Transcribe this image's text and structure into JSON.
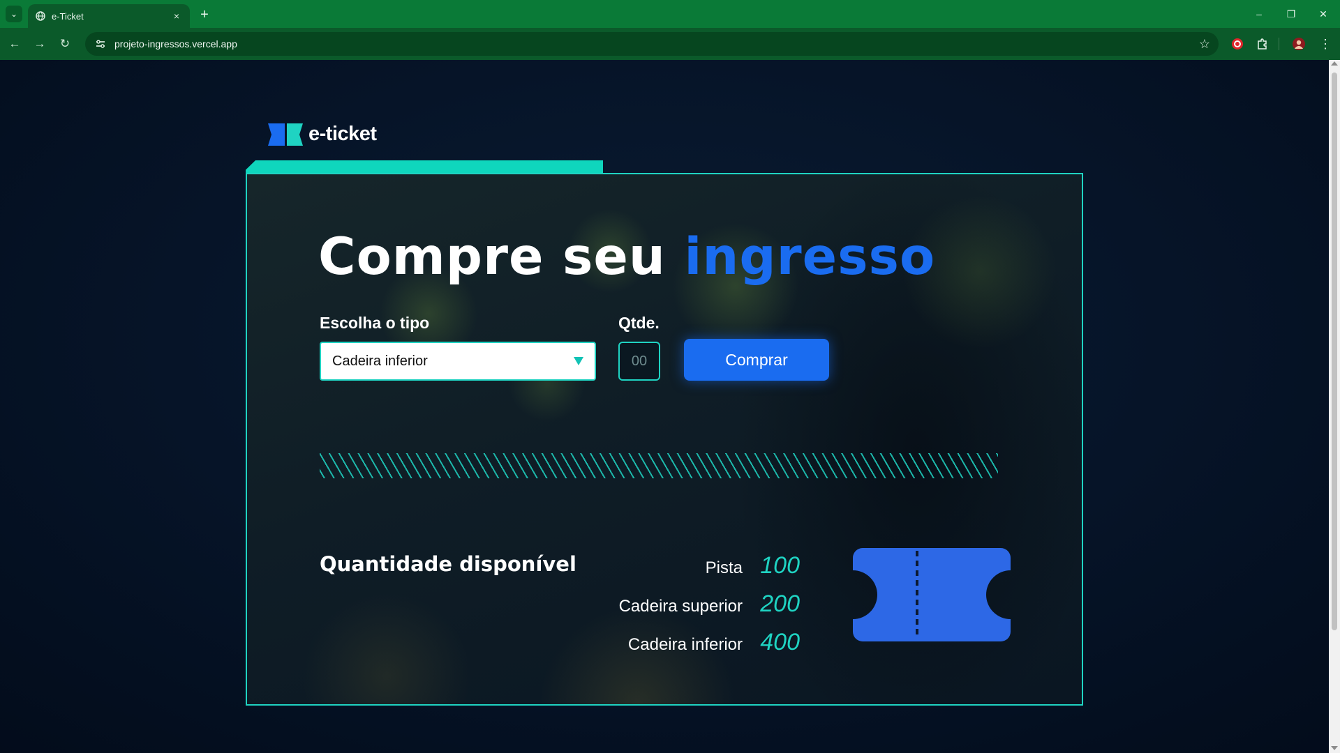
{
  "browser": {
    "tab_title": "e-Ticket",
    "tab_close": "×",
    "new_tab": "+",
    "url": "projeto-ingressos.vercel.app",
    "controls": {
      "minimize": "–",
      "restore": "❐",
      "close": "✕"
    },
    "icons": [
      "tab-list-icon",
      "globe-icon",
      "back-arrow-icon",
      "forward-arrow-icon",
      "reload-icon",
      "site-info-icon",
      "star-icon",
      "extension-red-icon",
      "puzzle-icon",
      "profile-avatar-icon",
      "kebab-menu-icon"
    ]
  },
  "page": {
    "logo_text": "e-ticket",
    "headline_part1": "Compre seu",
    "headline_part2": "ingresso",
    "type_label": "Escolha o tipo",
    "type_selected": "Cadeira inferior",
    "qty_label": "Qtde.",
    "qty_placeholder": "00",
    "buy_button": "Comprar",
    "availability_title": "Quantidade disponível",
    "availability": [
      {
        "name": "Pista",
        "count": "100"
      },
      {
        "name": "Cadeira superior",
        "count": "200"
      },
      {
        "name": "Cadeira inferior",
        "count": "400"
      }
    ]
  },
  "colors": {
    "accent_teal": "#1fd3c2",
    "accent_blue": "#1a6cf0",
    "chrome_green": "#0b5a2a"
  }
}
